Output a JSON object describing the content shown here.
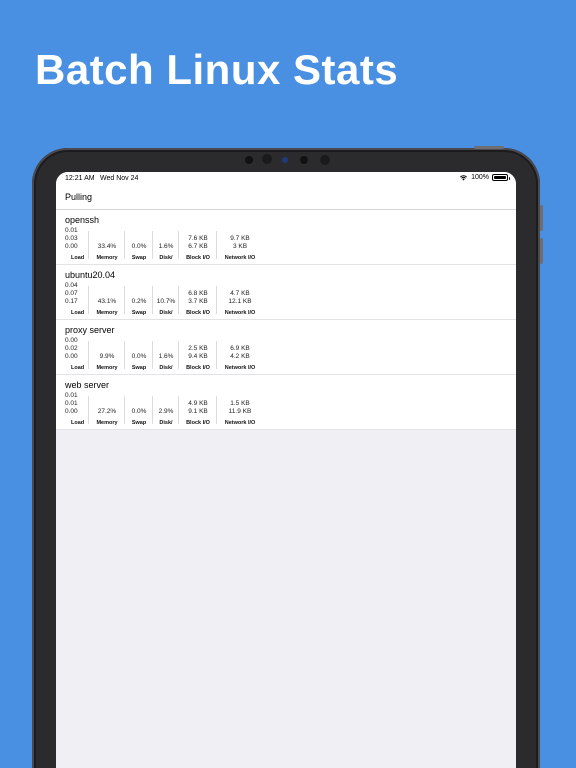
{
  "promo": {
    "title": "Batch Linux Stats"
  },
  "status_bar": {
    "time": "12:21 AM",
    "date": "Wed Nov 24",
    "battery": "100%",
    "battery_level": 1.0
  },
  "nav": {
    "title": "Pulling"
  },
  "labels": {
    "load": "Load",
    "memory": "Memory",
    "swap": "Swap",
    "disk": "Disk/",
    "block_io": "Block I/O",
    "network_io": "Network I/O"
  },
  "servers": [
    {
      "name": "openssh",
      "load": [
        "0.01",
        "0.03",
        "0.00"
      ],
      "memory": "33.4%",
      "swap": "0.0%",
      "disk": "1.6%",
      "block_io": [
        "7.6 KB",
        "6.7 KB"
      ],
      "network_io": [
        "9.7 KB",
        "3 KB"
      ]
    },
    {
      "name": "ubuntu20.04",
      "load": [
        "0.04",
        "0.07",
        "0.17"
      ],
      "memory": "43.1%",
      "swap": "0.2%",
      "disk": "10.7%",
      "block_io": [
        "6.8 KB",
        "3.7 KB"
      ],
      "network_io": [
        "4.7 KB",
        "12.1 KB"
      ]
    },
    {
      "name": "proxy server",
      "load": [
        "0.00",
        "0.02",
        "0.00"
      ],
      "memory": "9.9%",
      "swap": "0.0%",
      "disk": "1.6%",
      "block_io": [
        "2.5 KB",
        "9.4 KB"
      ],
      "network_io": [
        "6.9 KB",
        "4.2 KB"
      ]
    },
    {
      "name": "web server",
      "load": [
        "0.01",
        "0.01",
        "0.00"
      ],
      "memory": "27.2%",
      "swap": "0.0%",
      "disk": "2.9%",
      "block_io": [
        "4.9 KB",
        "9.1 KB"
      ],
      "network_io": [
        "1.5 KB",
        "11.9 KB"
      ]
    }
  ],
  "colors": {
    "background": "#4a90e2",
    "screen_bg": "#efeff4",
    "device_frame": "#2b2b2d"
  }
}
